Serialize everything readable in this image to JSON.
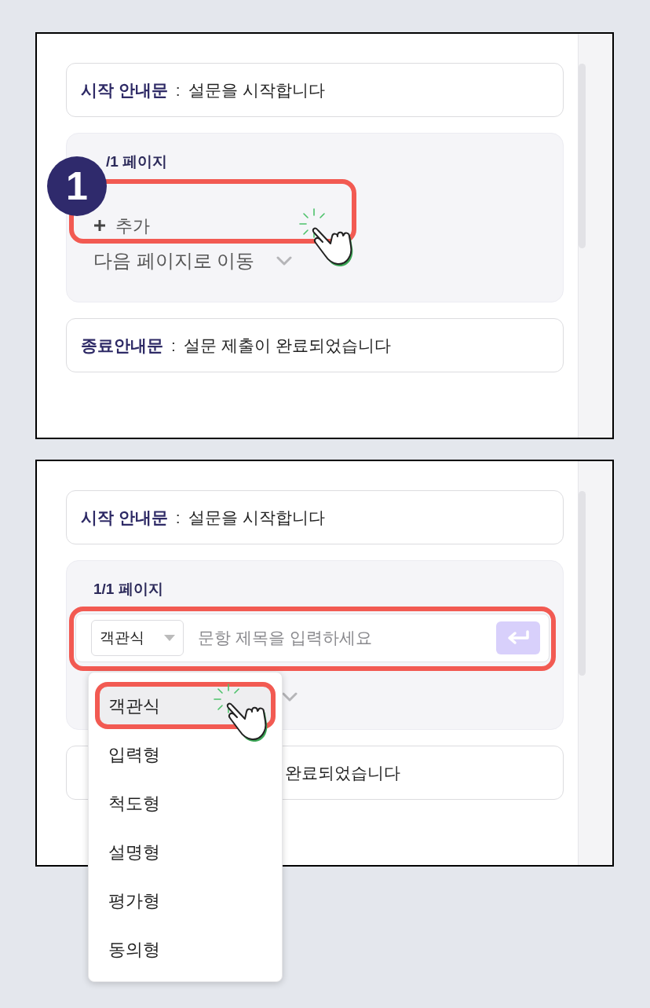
{
  "step_1": {
    "start_notice": {
      "label": "시작 안내문",
      "separator": ":",
      "text": "설문을 시작합니다"
    },
    "page": {
      "title": "/1 페이지",
      "step_badge": "1",
      "add_button": {
        "label": "추가",
        "highlighted": true
      },
      "next_action": "다음 페이지로 이동"
    },
    "end_notice": {
      "label": "종료안내문",
      "separator": ":",
      "text": "설문 제출이 완료되었습니다"
    }
  },
  "step_2": {
    "start_notice": {
      "label": "시작 안내문",
      "separator": ":",
      "text": "설문을 시작합니다"
    },
    "page": {
      "title": "1/1 페이지",
      "question_input": {
        "type_select": "객관식",
        "placeholder": "문항 제목을 입력하세요",
        "highlighted": true
      }
    },
    "type_menu": [
      {
        "label": "객관식",
        "selected": true
      },
      {
        "label": "입력형",
        "selected": false
      },
      {
        "label": "척도형",
        "selected": false
      },
      {
        "label": "설명형",
        "selected": false
      },
      {
        "label": "평가형",
        "selected": false
      },
      {
        "label": "동의형",
        "selected": false
      }
    ],
    "end_notice": {
      "text": "완료되었습니다"
    }
  }
}
